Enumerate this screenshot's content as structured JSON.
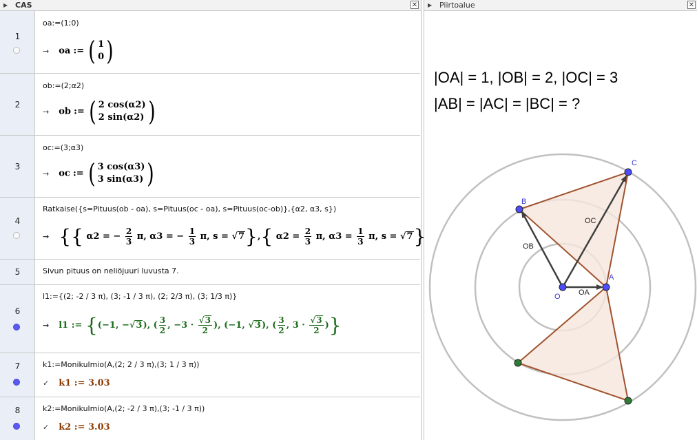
{
  "cas": {
    "title": "CAS",
    "close": "✕",
    "rows": [
      {
        "num": "1",
        "input": "oa:=(1;0)",
        "toggle": "off",
        "out_name": "oa",
        "out_assign": ":=",
        "m1": "1",
        "m2": "0"
      },
      {
        "num": "2",
        "input": "ob:=(2;α2)",
        "toggle": "off",
        "out_name": "ob",
        "out_assign": ":=",
        "m1": "2  cos(α2)",
        "m2": "2  sin(α2)"
      },
      {
        "num": "3",
        "input": "oc:=(3;α3)",
        "toggle": "off",
        "out_name": "oc",
        "out_assign": ":=",
        "m1": "3  cos(α3)",
        "m2": "3  sin(α3)"
      },
      {
        "num": "4",
        "input": "Ratkaise({s=Pituus(ob - oa), s=Pituus(oc - oa), s=Pituus(oc-ob)},{α2, α3, s})",
        "toggle": "off",
        "sol_a2_1": "α2 = −",
        "sol_f1n": "2",
        "sol_f1d": "3",
        "sol_pi": "π,",
        "sol_a3_1": "α3 = −",
        "sol_f2n": "1",
        "sol_f2d": "3",
        "sol_s": "π, s =",
        "sol_root": "7",
        "sol2_a2": "α2 =",
        "sol2_a3": "α3 ="
      },
      {
        "num": "5",
        "input": "Sivun pituus on neliöjuuri luvusta 7."
      },
      {
        "num": "6",
        "input": "l1:={(2; -2 / 3 π), (3; -1 / 3 π), (2; 2/3 π), (3; 1/3 π)}",
        "toggle": "on",
        "out_name": "l1",
        "out_assign": ":=",
        "p1": "−1, −",
        "p_root": "3",
        "p2a": "3",
        "p2b": "2",
        "p2c": ", −3 ·",
        "p3": "−1, ",
        "p4c": ", 3 ·"
      },
      {
        "num": "7",
        "input": "k1:=Monikulmio(A,(2; 2 / 3 π),(3; 1 / 3 π))",
        "toggle": "on",
        "check": "✓",
        "out": "k1 := 3.03"
      },
      {
        "num": "8",
        "input": "k2:=Monikulmio(A,(2; -2 / 3 π),(3; -1 / 3 π))",
        "toggle": "on",
        "check": "✓",
        "out": "k2 := 3.03"
      }
    ],
    "arrow": "→"
  },
  "graphics": {
    "title": "Piirtoalue",
    "close": "✕",
    "text_line1": "|OA| = 1, |OB| = 2, |OC| = 3",
    "text_line2": "|AB| = |AC| = |BC| = ?",
    "labels": {
      "A": "A",
      "B": "B",
      "C": "C",
      "O": "O",
      "OA": "OA",
      "OB": "OB",
      "OC": "OC"
    },
    "colors": {
      "circle": "#c0c0c0",
      "polygon_stroke": "#a0522d",
      "polygon_fill": "#f5e6dc",
      "vector": "#404040",
      "point": "#4d4dff",
      "point_green": "#2e7d32",
      "label": "#3a3ad0"
    }
  }
}
